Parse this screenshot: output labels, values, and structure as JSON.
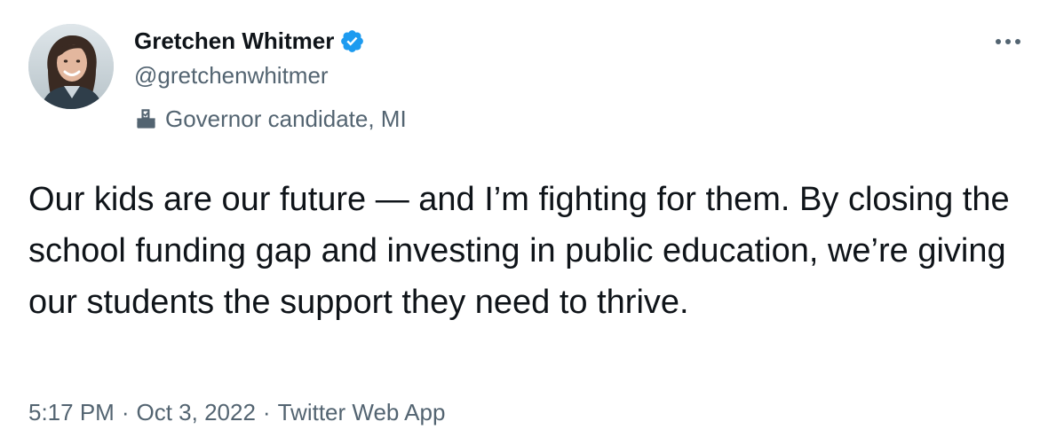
{
  "author": {
    "display_name": "Gretchen Whitmer",
    "handle": "@gretchenwhitmer",
    "verified": true,
    "label": "Governor candidate, MI",
    "label_icon": "ballot-box-icon",
    "avatar_icon": "profile-photo"
  },
  "tweet": {
    "text": "Our kids are our future — and I’m fighting for them. By closing the school funding gap and investing in public education, we’re giving our students the support they need to thrive."
  },
  "meta": {
    "time": "5:17 PM",
    "separator": "·",
    "date": "Oct 3, 2022",
    "source": "Twitter Web App"
  },
  "colors": {
    "text_primary": "#0f1419",
    "text_secondary": "#536471",
    "verified_blue": "#1d9bf0"
  },
  "icons": {
    "more": "more-horizontal-icon",
    "verified": "verified-badge-icon"
  }
}
